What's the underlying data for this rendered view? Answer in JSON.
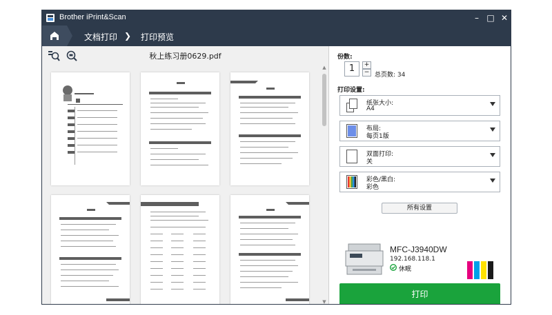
{
  "window": {
    "title": "Brother iPrint&Scan",
    "controls": {
      "minimize": "–",
      "maximize": "□",
      "close": "✕"
    }
  },
  "nav": {
    "home_icon": "home-icon",
    "crumb1": "文档打印",
    "crumb2": "打印预览"
  },
  "preview": {
    "filename": "秋上练习册0629.pdf",
    "zoom_in_icon": "zoom-in-icon",
    "zoom_fit_icon": "zoom-icon"
  },
  "copies": {
    "label": "份数:",
    "value": "1",
    "plus": "+",
    "minus": "−",
    "total": "总页数: 34"
  },
  "settings": {
    "label": "打印设置:",
    "paper": {
      "title": "纸张大小:",
      "value": "A4"
    },
    "layout": {
      "title": "布局:",
      "value": "每页1版"
    },
    "duplex": {
      "title": "双面打印:",
      "value": "关"
    },
    "color": {
      "title": "彩色/黑白:",
      "value": "彩色"
    },
    "all_settings": "所有设置"
  },
  "printer": {
    "model": "MFC-J3940DW",
    "ip": "192.168.118.1",
    "status": "休眠"
  },
  "ink_colors": [
    "#e6007e",
    "#00a0e9",
    "#ffe100",
    "#1a1a1a"
  ],
  "print_button": "打印",
  "accent": "#1aa33c",
  "titlebar_color": "#2d3a4b"
}
